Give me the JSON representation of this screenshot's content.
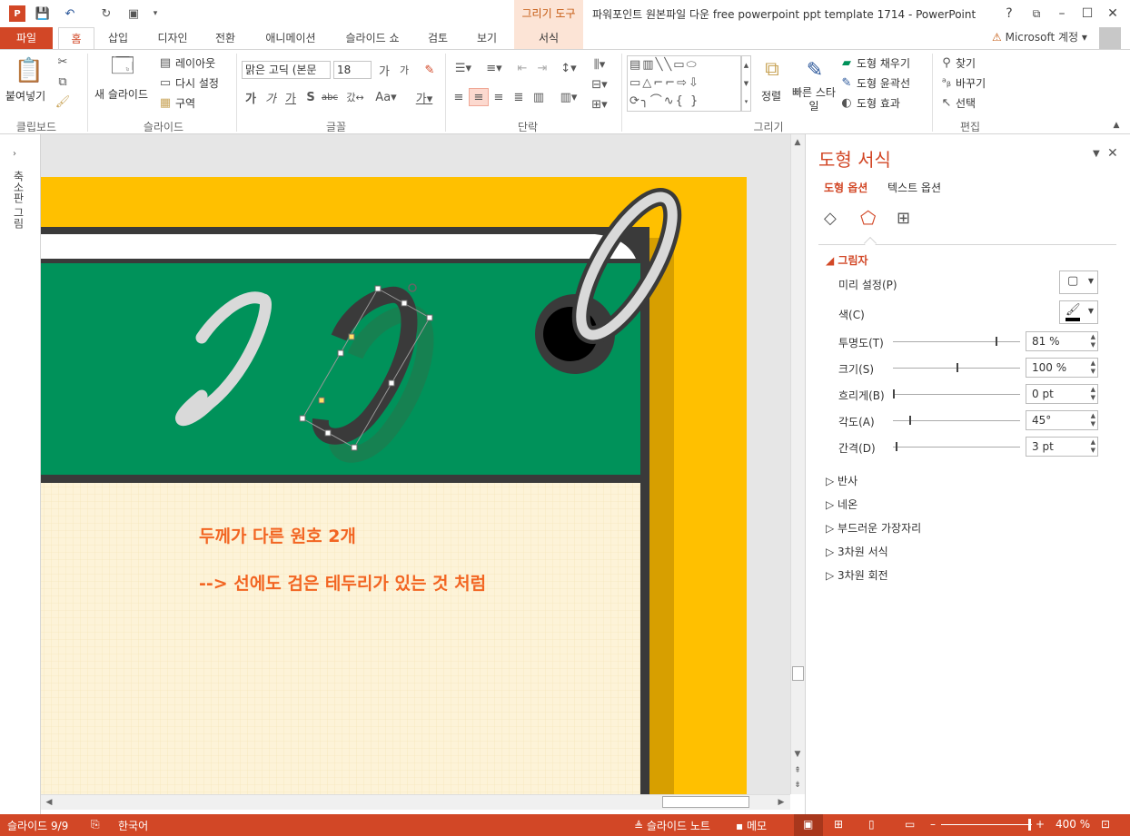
{
  "titlebar": {
    "title": "파워포인트 원본파일 다운 free powerpoint ppt template 1714 - PowerPoint",
    "context_tab": "그리기 도구",
    "help": "?",
    "win_min": "–",
    "win_max": "☐",
    "win_close": "✕",
    "restore": "⧉"
  },
  "tabs": {
    "file": "파일",
    "home": "홈",
    "insert": "삽입",
    "design": "디자인",
    "transitions": "전환",
    "animations": "애니메이션",
    "slideshow": "슬라이드 쇼",
    "review": "검토",
    "view": "보기",
    "format": "서식",
    "account": "Microsoft 계정"
  },
  "ribbon": {
    "clipboard": {
      "paste": "붙여넣기",
      "label": "클립보드"
    },
    "slides": {
      "new_slide": "새 슬라이드",
      "layout": "레이아웃",
      "reset": "다시 설정",
      "section": "구역",
      "label": "슬라이드"
    },
    "font": {
      "font_name": "맑은 고딕 (본문",
      "font_size": "18",
      "label": "글꼴"
    },
    "paragraph": {
      "label": "단락"
    },
    "drawing": {
      "arrange": "정렬",
      "quick_styles": "빠른 스타일",
      "shape_fill": "도형 채우기",
      "shape_outline": "도형 윤곽선",
      "shape_effects": "도형 효과",
      "label": "그리기"
    },
    "editing": {
      "find": "찾기",
      "replace": "바꾸기",
      "select": "선택",
      "label": "편집"
    }
  },
  "thumbstrip": {
    "label": "축소판 그림"
  },
  "slide": {
    "text_line1": "두께가 다른 원호 2개",
    "text_line2": "--> 선에도 검은 테두리가 있는 것 처럼"
  },
  "format_pane": {
    "title": "도형 서식",
    "tab_shape": "도형 옵션",
    "tab_text": "텍스트 옵션",
    "shadow_section": "그림자",
    "presets": "미리 설정(P)",
    "color": "색(C)",
    "transparency": {
      "label": "투명도(T)",
      "value": "81 %",
      "fraction": 0.81
    },
    "size": {
      "label": "크기(S)",
      "value": "100 %",
      "fraction": 0.5
    },
    "blur": {
      "label": "흐리게(B)",
      "value": "0 pt",
      "fraction": 0.0
    },
    "angle": {
      "label": "각도(A)",
      "value": "45°",
      "fraction": 0.125
    },
    "distance": {
      "label": "간격(D)",
      "value": "3 pt",
      "fraction": 0.02
    },
    "sections": [
      "반사",
      "네온",
      "부드러운 가장자리",
      "3차원 서식",
      "3차원 회전"
    ]
  },
  "statusbar": {
    "slide": "슬라이드 9/9",
    "language": "한국어",
    "notes": "슬라이드 노트",
    "comments": "메모",
    "zoom": "400 %"
  },
  "colors": {
    "accent": "#d24726",
    "slide_yellow": "#ffc000",
    "slide_green": "#00925a",
    "text_orange": "#f26522"
  }
}
